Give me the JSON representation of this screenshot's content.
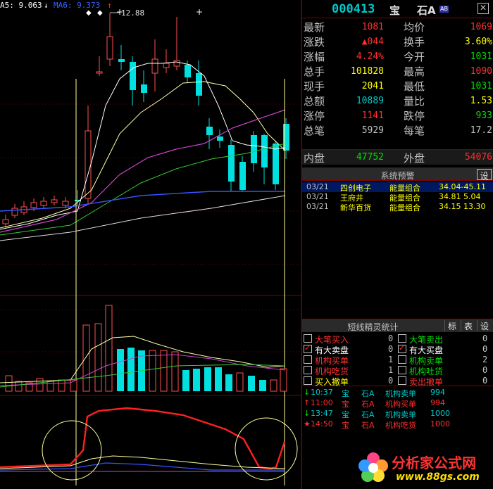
{
  "chart": {
    "ma_labels": [
      {
        "text": "A5: 9.063",
        "color": "#ffffff"
      },
      {
        "text": "↓",
        "color": "#ffffff"
      },
      {
        "text": "MA6: 9.373",
        "color": "#3366ff"
      },
      {
        "text": "↑",
        "color": "#ff3030"
      }
    ],
    "high_marker": "12.88",
    "up_color": "#ff5050",
    "down_color": "#00e0e0"
  },
  "header": {
    "code": "000413",
    "name_part1": "宝",
    "name_part2": "石A",
    "badge": "AB",
    "close_icon": "close-icon"
  },
  "quote": {
    "rows": [
      {
        "l1": "最新",
        "v1": "1081",
        "c1": "#ff3030",
        "l2": "均价",
        "v2": "1069",
        "c2": "#ff3030"
      },
      {
        "l1": "涨跌",
        "v1": "▲044",
        "c1": "#ff3030",
        "l2": "换手",
        "v2": "3.60%",
        "c2": "#ffff00"
      },
      {
        "l1": "涨幅",
        "v1": "4.24%",
        "c1": "#ff3030",
        "l2": "今开",
        "v2": "1031",
        "c2": "#00e000"
      },
      {
        "l1": "总手",
        "v1": "101828",
        "c1": "#ffff00",
        "l2": "最高",
        "v2": "1090",
        "c2": "#ff3030"
      },
      {
        "l1": "现手",
        "v1": "2041",
        "c1": "#ffff00",
        "l2": "最低",
        "v2": "1031",
        "c2": "#00e000"
      },
      {
        "l1": "总额",
        "v1": "10889",
        "c1": "#00c8c8",
        "l2": "量比",
        "v2": "1.53",
        "c2": "#ffff00"
      },
      {
        "l1": "涨停",
        "v1": "1141",
        "c1": "#ff3030",
        "l2": "跌停",
        "v2": "933",
        "c2": "#00e000"
      },
      {
        "l1": "总笔",
        "v1": "5929",
        "c1": "#c0c0c0",
        "l2": "每笔",
        "v2": "17.2",
        "c2": "#c0c0c0"
      }
    ],
    "inner_label": "内盘",
    "inner_value": "47752",
    "outer_label": "外盘",
    "outer_value": "54076"
  },
  "alerts": {
    "title": "系统预警",
    "settings": "设",
    "items": [
      {
        "date": "03/21",
        "name": "四创电子",
        "type": "能量组合",
        "range": "34.04-45.11"
      },
      {
        "date": "03/21",
        "name": "王府井",
        "type": "能量组合",
        "range": "34.81  5.04"
      },
      {
        "date": "03/21",
        "name": "新华百货",
        "type": "能量组合",
        "range": "34.15 13.30"
      }
    ]
  },
  "stats": {
    "title": "短线精灵统计",
    "btn_mark": "标",
    "btn_table": "表",
    "btn_settings": "设",
    "left": [
      {
        "label": "大笔买入",
        "value": "0",
        "checked": false,
        "color": "#ff3030"
      },
      {
        "label": "有大卖盘",
        "value": "0",
        "checked": true,
        "color": "#ffffff"
      },
      {
        "label": "机构买单",
        "value": "1",
        "checked": false,
        "color": "#ff3030"
      },
      {
        "label": "机构吃货",
        "value": "1",
        "checked": false,
        "color": "#ff3030"
      },
      {
        "label": "买入撤单",
        "value": "0",
        "checked": false,
        "color": "#ffff00"
      }
    ],
    "right": [
      {
        "label": "大笔卖出",
        "value": "0",
        "checked": false,
        "color": "#00e000"
      },
      {
        "label": "有大买盘",
        "value": "0",
        "checked": true,
        "color": "#ffffff"
      },
      {
        "label": "机构卖单",
        "value": "2",
        "checked": false,
        "color": "#00e000"
      },
      {
        "label": "机构吐货",
        "value": "0",
        "checked": false,
        "color": "#00e000"
      },
      {
        "label": "卖出撤单",
        "value": "0",
        "checked": false,
        "color": "#ff3030"
      }
    ]
  },
  "log": [
    {
      "arrow": "↓",
      "arrow_color": "#00e000",
      "time": "10:37",
      "s1": "宝",
      "s2": "石A",
      "event": "机构卖单",
      "vol": "994",
      "color": "#00c8c8"
    },
    {
      "arrow": "↑",
      "arrow_color": "#ff3030",
      "time": "11:00",
      "s1": "宝",
      "s2": "石A",
      "event": "机构买单",
      "vol": "994",
      "color": "#ff3030"
    },
    {
      "arrow": "↓",
      "arrow_color": "#00e000",
      "time": "13:47",
      "s1": "宝",
      "s2": "石A",
      "event": "机构卖单",
      "vol": "1000",
      "color": "#00c8c8"
    },
    {
      "arrow": "★",
      "arrow_color": "#ff3030",
      "time": "14:50",
      "s1": "宝",
      "s2": "石A",
      "event": "机构吃货",
      "vol": "1000",
      "color": "#ff3030"
    }
  ],
  "watermark": {
    "name": "分析家公式网",
    "url": "www.88gs.com"
  }
}
